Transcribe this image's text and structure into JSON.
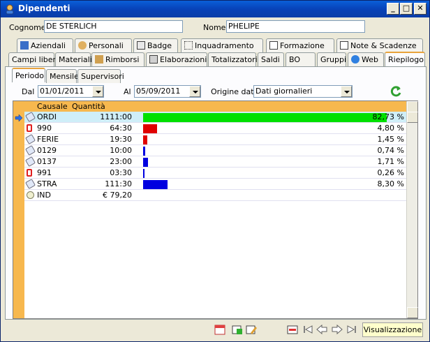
{
  "window": {
    "title": "Dipendenti"
  },
  "fields": {
    "cognome_label": "Cognome",
    "cognome_value": "DE STERLICH",
    "nome_label": "Nome",
    "nome_value": "PHELIPE"
  },
  "tabs_row1": [
    "Aziendali",
    "Personali",
    "Badge",
    "Inquadramento",
    "Formazione",
    "Note & Scadenze"
  ],
  "tabs_row2": [
    "Campi liberi",
    "Materiali",
    "Rimborsi",
    "Elaborazioni",
    "Totalizzatori",
    "Saldi",
    "BO",
    "Gruppi",
    "Web",
    "Riepilogo"
  ],
  "subtabs": [
    "Periodo",
    "Mensile",
    "Supervisori"
  ],
  "filters": {
    "dal_label": "Dal",
    "dal_value": "01/01/2011",
    "al_label": "Al",
    "al_value": "05/09/2011",
    "origine_label": "Origine dati",
    "origine_value": "Dati giornalieri"
  },
  "grid": {
    "headers": [
      "Causale",
      "Quantità"
    ],
    "rows": [
      {
        "causale": "ORDI",
        "quantita": "1111:00",
        "pct_label": "82,73 %",
        "pct": 82.73,
        "color": "#00e000",
        "icon": "tag-icon"
      },
      {
        "causale": "990",
        "quantita": "64:30",
        "pct_label": "4,80 %",
        "pct": 4.8,
        "color": "#e00000",
        "icon": "phone-icon"
      },
      {
        "causale": "FERIE",
        "quantita": "19:30",
        "pct_label": "1,45 %",
        "pct": 1.45,
        "color": "#e00000",
        "icon": "tag-icon"
      },
      {
        "causale": "0129",
        "quantita": "10:00",
        "pct_label": "0,74 %",
        "pct": 0.74,
        "color": "#0000e0",
        "icon": "tag-icon"
      },
      {
        "causale": "0137",
        "quantita": "23:00",
        "pct_label": "1,71 %",
        "pct": 1.71,
        "color": "#0000e0",
        "icon": "tag-icon"
      },
      {
        "causale": "991",
        "quantita": "03:30",
        "pct_label": "0,26 %",
        "pct": 0.26,
        "color": "#0000e0",
        "icon": "phone-icon"
      },
      {
        "causale": "STRA",
        "quantita": "111:30",
        "pct_label": "8,30 %",
        "pct": 8.3,
        "color": "#0000e0",
        "icon": "tag-icon"
      },
      {
        "causale": "IND",
        "quantita": "€ 79,20",
        "pct_label": "",
        "pct": 0,
        "color": "#ffffff",
        "icon": "money-icon"
      }
    ]
  },
  "status": {
    "mode": "Visualizzazione"
  }
}
